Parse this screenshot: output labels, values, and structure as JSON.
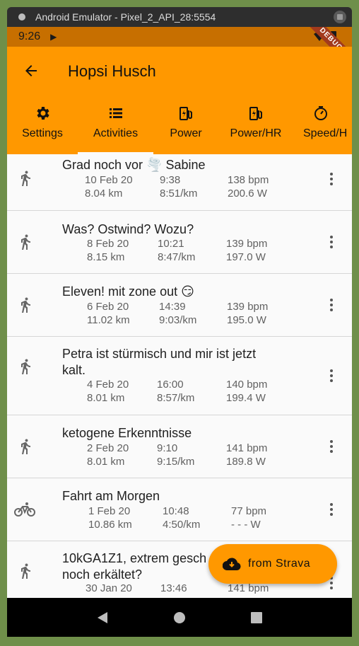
{
  "window": {
    "title": "Android Emulator - Pixel_2_API_28:5554"
  },
  "statusbar": {
    "time": "9:26"
  },
  "debug_banner": "DEBUG",
  "appbar": {
    "title": "Hopsi Husch"
  },
  "tabs": [
    {
      "label": "Settings",
      "icon": "gear-icon"
    },
    {
      "label": "Activities",
      "icon": "list-icon",
      "active": true
    },
    {
      "label": "Power",
      "icon": "power-icon"
    },
    {
      "label": "Power/HR",
      "icon": "power-hr-icon"
    },
    {
      "label": "Speed/H",
      "icon": "stopwatch-icon"
    }
  ],
  "activities": [
    {
      "type": "run",
      "title": "Grad noch vor 🌪️ Sabine",
      "date": "10 Feb 20",
      "duration": "9:38",
      "hr": "138 bpm",
      "distance": "8.04 km",
      "pace": "8:51/km",
      "power": "200.6 W"
    },
    {
      "type": "run",
      "title": "Was? Ostwind? Wozu?",
      "date": "8 Feb 20",
      "duration": "10:21",
      "hr": "139 bpm",
      "distance": "8.15 km",
      "pace": "8:47/km",
      "power": "197.0 W"
    },
    {
      "type": "run",
      "title": "Eleven! mit zone out 😏",
      "date": "6 Feb 20",
      "duration": "14:39",
      "hr": "139 bpm",
      "distance": "11.02 km",
      "pace": "9:03/km",
      "power": "195.0 W"
    },
    {
      "type": "run",
      "title": "Petra ist stürmisch und mir ist jetzt kalt.",
      "date": "4 Feb 20",
      "duration": "16:00",
      "hr": "140 bpm",
      "distance": "8.01 km",
      "pace": "8:57/km",
      "power": "199.4 W"
    },
    {
      "type": "run",
      "title": "ketogene Erkenntnisse",
      "date": "2 Feb 20",
      "duration": "9:10",
      "hr": "141 bpm",
      "distance": "8.01 km",
      "pace": "9:15/km",
      "power": "189.8 W"
    },
    {
      "type": "bike",
      "title": "Fahrt am Morgen",
      "date": "1 Feb 20",
      "duration": "10:48",
      "hr": "77 bpm",
      "distance": "10.86 km",
      "pace": "4:50/km",
      "power": "- - - W"
    },
    {
      "type": "run",
      "title": "10kGA1Z1, extrem gesch noch erkältet?",
      "date": "30 Jan 20",
      "duration": "13:46",
      "hr": "141 bpm",
      "distance": "",
      "pace": "",
      "power": ""
    }
  ],
  "fab": {
    "label": "from Strava",
    "icon": "cloud-download-icon"
  },
  "colors": {
    "accent": "#ff9800",
    "statusbar": "#c76f00",
    "debug": "#a23a1d"
  }
}
